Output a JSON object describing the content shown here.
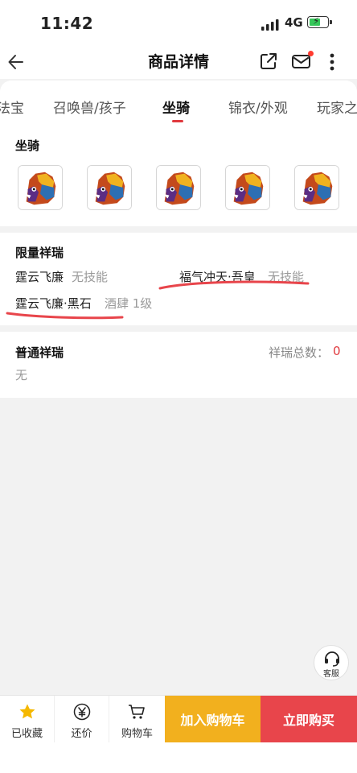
{
  "status_bar": {
    "time": "11:42",
    "network": "4G"
  },
  "navbar": {
    "title": "商品详情"
  },
  "tabs": [
    {
      "label": "法宝"
    },
    {
      "label": "召唤兽/孩子"
    },
    {
      "label": "坐骑"
    },
    {
      "label": "锦衣/外观"
    },
    {
      "label": "玩家之"
    }
  ],
  "mounts_section": {
    "title": "坐骑",
    "thumbnail_count": 5
  },
  "limited_section": {
    "title": "限量祥瑞",
    "items": [
      {
        "name": "霆云飞廉",
        "note": "无技能"
      },
      {
        "name": "福气冲天·吾皇",
        "note": "无技能"
      },
      {
        "name": "霆云飞廉·黑石",
        "note": "酒肆 1级"
      }
    ]
  },
  "normal_section": {
    "title": "普通祥瑞",
    "count_label": "祥瑞总数：",
    "count_value": "0",
    "empty_text": "无"
  },
  "service": {
    "label": "客服"
  },
  "bottom_bar": {
    "favorite_label": "已收藏",
    "bargain_label": "还价",
    "cart_label": "购物车",
    "add_to_cart": "加入购物车",
    "buy_now": "立即购买"
  },
  "colors": {
    "accent": "#e8454b",
    "cart_button": "#f2b01e",
    "favorite_star": "#f5b800",
    "count_value": "#e0393e"
  }
}
